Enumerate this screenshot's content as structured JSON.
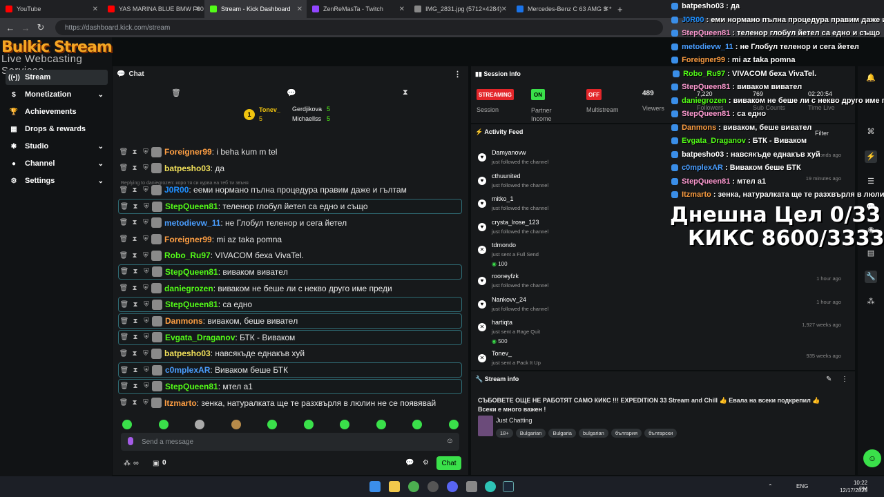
{
  "browser": {
    "tabs": [
      {
        "label": "YouTube",
        "color": "#ff0000"
      },
      {
        "label": "YAS MARINA BLUE BMW F80 M",
        "color": "#ff0000"
      },
      {
        "label": "Stream - Kick Dashboard",
        "color": "#53fc18"
      },
      {
        "label": "ZenReMasTa - Twitch",
        "color": "#9146ff"
      },
      {
        "label": "IMG_2831.jpg (5712×4284)",
        "color": "#888888"
      },
      {
        "label": "Mercedes-Benz C 63 AMG S *",
        "color": "#1a73e8"
      }
    ],
    "url": "https://dashboard.kick.com/stream"
  },
  "logo": {
    "line1": "Bulkic Stream",
    "line2": "Live Webcasting Services"
  },
  "nav": [
    {
      "label": "Stream",
      "icon": "radio-icon"
    },
    {
      "label": "Monetization",
      "icon": "dollar-icon",
      "chev": true
    },
    {
      "label": "Achievements",
      "icon": "trophy-icon"
    },
    {
      "label": "Drops & rewards",
      "icon": "gift-icon"
    },
    {
      "label": "Studio",
      "icon": "gear-icon",
      "chev": true
    },
    {
      "label": "Channel",
      "icon": "user-icon",
      "chev": true
    },
    {
      "label": "Settings",
      "icon": "settings-icon",
      "chev": true
    }
  ],
  "chat": {
    "title": "Chat",
    "pinned": {
      "top": "Tonev_",
      "top_count": "5",
      "second": "Gerdjikova",
      "second_count": "5",
      "third": "Michaellss",
      "third_count": "5",
      "rank": "1"
    },
    "partial_top": "...",
    "reply_hint": "Replying to daniegrozen: коро тя си курва на теб ти звъня",
    "messages": [
      {
        "user": "Foreigner99",
        "color": "#ff9f43",
        "text": "i beha kum m tel",
        "box": false
      },
      {
        "user": "batpesho03",
        "color": "#f1e05a",
        "text": "да",
        "box": false
      },
      {
        "user": "J0R00",
        "color": "#1f8fff",
        "text": "ееми нормано пълна процедура правим даже и гълтам",
        "box": false
      },
      {
        "user": "StepQueen81",
        "color": "#53fc18",
        "text": "теленор глобул йетел са едно и също",
        "box": true
      },
      {
        "user": "metodievw_11",
        "color": "#4a9eff",
        "text": "не Глобул теленор и сега йетел",
        "box": false
      },
      {
        "user": "Foreigner99",
        "color": "#ff9f43",
        "text": "mi az taka pomna",
        "box": false
      },
      {
        "user": "Robo_Ru97",
        "color": "#53fc18",
        "text": "VIVACOM беха VivaTel.",
        "box": false
      },
      {
        "user": "StepQueen81",
        "color": "#53fc18",
        "text": "виваком виватeл",
        "box": true
      },
      {
        "user": "daniegrozen",
        "color": "#53fc18",
        "text": "виваком не беше ли с нeкво друго име преди",
        "box": false
      },
      {
        "user": "StepQueen81",
        "color": "#53fc18",
        "text": "са едно",
        "box": true
      },
      {
        "user": "Danmons",
        "color": "#ff9f43",
        "text": "виваком, беше виватeл",
        "box": true
      },
      {
        "user": "Evgata_Draganov",
        "color": "#53fc18",
        "text": "БТК - Виваком",
        "box": true
      },
      {
        "user": "batpesho03",
        "color": "#f1e05a",
        "text": "навсякъде еднакъв хуй",
        "box": false
      },
      {
        "user": "c0mplexAR",
        "color": "#4a9eff",
        "text": "Виваком беше БТК",
        "box": true
      },
      {
        "user": "StepQueen81",
        "color": "#53fc18",
        "text": "мтел а1",
        "box": true
      },
      {
        "user": "Itzmarto",
        "color": "#ff9f43",
        "text": "зенка, натуралката ще те разхвърля в люлин не се появявай",
        "box": false
      }
    ],
    "placeholder": "Send a message",
    "send_label": "Chat",
    "viewers_label": "∞",
    "points": "0"
  },
  "session": {
    "title": "Session Info",
    "streaming": "STREAMING",
    "partner_on": "ON",
    "multistream_off": "OFF",
    "session_label": "Session",
    "partner_label": "Partner Income",
    "multistream_label": "Multistream",
    "viewers": "489",
    "viewers_label": "Viewers",
    "followers": "7,220",
    "followers_label": "Followers",
    "subs": "769",
    "subs_label": "Sub Counts",
    "time": "02:20:54",
    "time_label": "Time Live"
  },
  "activity": {
    "title": "Activity Feed",
    "filter": "Filter",
    "items": [
      {
        "name": "Damyanovw",
        "sub": "just followed the channel",
        "time": "9 seconds ago",
        "kind": "follow"
      },
      {
        "name": "cthuunited",
        "sub": "just followed the channel",
        "time": "19 minutes ago",
        "kind": "follow"
      },
      {
        "name": "mitko_1",
        "sub": "just followed the channel",
        "time": "",
        "kind": "follow"
      },
      {
        "name": "crysta_lrose_123",
        "sub": "just followed the channel",
        "time": "",
        "kind": "follow"
      },
      {
        "name": "tdmondo",
        "sub": "just sent a Full Send",
        "time": "",
        "kind": "send",
        "coins": "100"
      },
      {
        "name": "rooneyfzk",
        "sub": "just followed the channel",
        "time": "1 hour ago",
        "kind": "follow"
      },
      {
        "name": "Nankovv_24",
        "sub": "just followed the channel",
        "time": "1 hour ago",
        "kind": "follow"
      },
      {
        "name": "hartiqta",
        "sub": "just sent a Rage Quit",
        "time": "1,927 weeks ago",
        "kind": "send",
        "coins": "500"
      },
      {
        "name": "Tonev_",
        "sub": "just sent a Pack It Up",
        "time": "935 weeks ago",
        "kind": "send"
      }
    ]
  },
  "streaminfo": {
    "title": "Stream info",
    "stream_title": "СЪБОВЕТЕ ОЩЕ НЕ РАБОТЯТ САМО КИКС !!! EXPEDITION 33 Stream and Chill 👍 Евала на всеки подкрепил 👍 Всеки е много важен !",
    "category": "Just Chatting",
    "tags": [
      "18+",
      "Bulgarian",
      "Bulgaria",
      "bulgarian",
      "българия",
      "български"
    ]
  },
  "overlay": {
    "lines": [
      {
        "user": "batpesho03",
        "text": "да",
        "color": "#ffffff"
      },
      {
        "user": "J0R00",
        "text": "еми нормано пълна процедура правим даже и гъ",
        "color": "#1f8fff"
      },
      {
        "user": "StepQueen81",
        "text": "теленор глобул йетел са едно и също",
        "color": "#ff9bd2"
      },
      {
        "user": "metodievw_11",
        "text": "не Глобул теленор и сега йетел",
        "color": "#4a9eff"
      },
      {
        "user": "Foreigner99",
        "text": "mi az taka pomna",
        "color": "#ff9f43"
      },
      {
        "user": "Robo_Ru97",
        "text": "VIVACOM беха VivaTel.",
        "color": "#53fc18"
      },
      {
        "user": "StepQueen81",
        "text": "виваком виватeл",
        "color": "#ff9bd2"
      },
      {
        "user": "daniegrozen",
        "text": "виваком не беше ли с нeкво друго име пре",
        "color": "#53fc18"
      },
      {
        "user": "StepQueen81",
        "text": "са едно",
        "color": "#ff9bd2"
      },
      {
        "user": "Danmons",
        "text": "виваком, беше виватeл",
        "color": "#ff9f43"
      },
      {
        "user": "Evgata_Draganov",
        "text": "БТК - Виваком",
        "color": "#53fc18"
      },
      {
        "user": "batpesho03",
        "text": "навсякъде еднакъв хуй",
        "color": "#ffffff"
      },
      {
        "user": "c0mplexAR",
        "text": "Виваком беше БТК",
        "color": "#4a9eff"
      },
      {
        "user": "StepQueen81",
        "text": "мтел а1",
        "color": "#ff9bd2"
      },
      {
        "user": "Itzmarto",
        "text": "зенка, натуралката ще те разхвърля в люлин не се",
        "color": "#ff9f43"
      }
    ],
    "goal1": "Днешна Цел 0/33",
    "goal2": "КИКС 8600/33333"
  },
  "taskbar": {
    "lang": "ENG",
    "time": "10:22 PM",
    "date": "12/17/2025"
  }
}
